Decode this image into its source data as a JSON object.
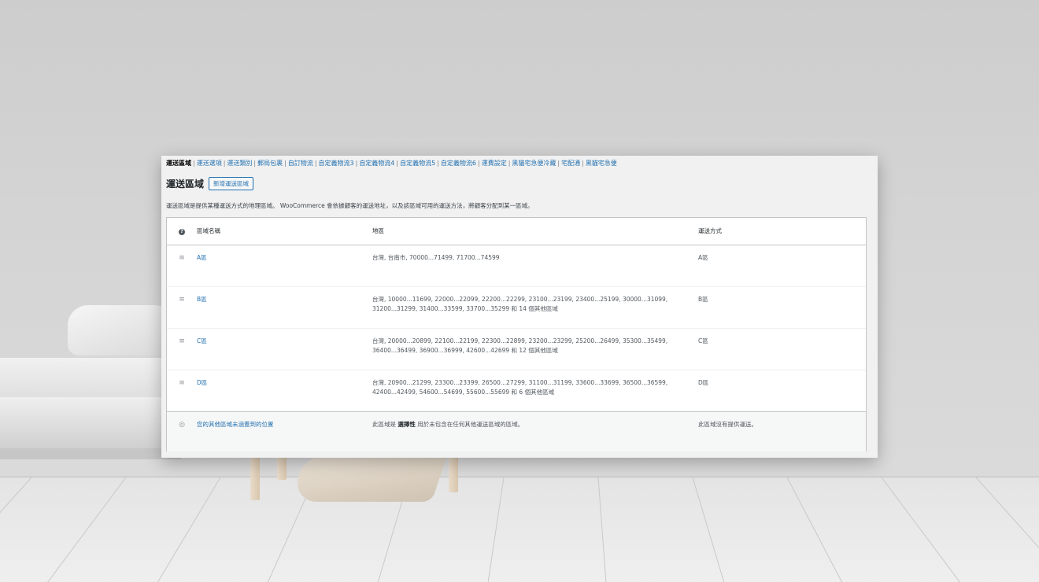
{
  "subnav": {
    "items": [
      {
        "label": "運送區域",
        "current": true
      },
      {
        "label": "運送選項",
        "current": false
      },
      {
        "label": "運送類別",
        "current": false
      },
      {
        "label": "郵局包裹",
        "current": false
      },
      {
        "label": "自訂物流",
        "current": false
      },
      {
        "label": "自定義物流3",
        "current": false
      },
      {
        "label": "自定義物流4",
        "current": false
      },
      {
        "label": "自定義物流5",
        "current": false
      },
      {
        "label": "自定義物流6",
        "current": false
      },
      {
        "label": "運費設定",
        "current": false
      },
      {
        "label": "黑貓宅急便冷藏",
        "current": false
      },
      {
        "label": "宅配通",
        "current": false
      },
      {
        "label": "黑貓宅急便",
        "current": false
      }
    ],
    "separator": "|"
  },
  "page": {
    "title": "運送區域",
    "add_button": "新增運送區域",
    "description": "運送區域是提供某種運送方式的地理區域。 WooCommerce 會依據顧客的運送地址，以及該區域可用的運送方法，將顧客分配到某一區域。"
  },
  "table": {
    "headers": {
      "help_icon": "?",
      "name": "區域名稱",
      "region": "地區",
      "method": "運送方式"
    },
    "zones": [
      {
        "name": "A區",
        "region": "台灣, 台南市, 70000...71499, 71700...74599",
        "method": "A區"
      },
      {
        "name": "B區",
        "region": "台灣, 10000...11699, 22000...22099, 22200...22299, 23100...23199, 23400...25199, 30000...31099, 31200...31299, 31400...33599, 33700...35299 和 14 個其他區域",
        "method": "B區"
      },
      {
        "name": "C區",
        "region": "台灣, 20000...20899, 22100...22199, 22300...22899, 23200...23299, 25200...26499, 35300...35499, 36400...36499, 36900...36999, 42600...42699 和 12 個其他區域",
        "method": "C區"
      },
      {
        "name": "D區",
        "region": "台灣, 20900...21299, 23300...23399, 26500...27299, 31100...31199, 33600...33699, 36500...36599, 42400...42499, 54600...54699, 55600...55699 和 6 個其他區域",
        "method": "D區"
      }
    ],
    "rest_of_world": {
      "name": "您的其他區域未涵蓋到的位置",
      "desc_prefix": "此區域是",
      "desc_strong": "選擇性",
      "desc_suffix": "用於未包含在任何其他運送區域的區域。",
      "method": "此區域沒有提供運送。"
    }
  },
  "icons": {
    "handle": "≡",
    "globe": "◎"
  },
  "colors": {
    "link": "#2271b1",
    "panel_bg": "#f1f1f1"
  }
}
